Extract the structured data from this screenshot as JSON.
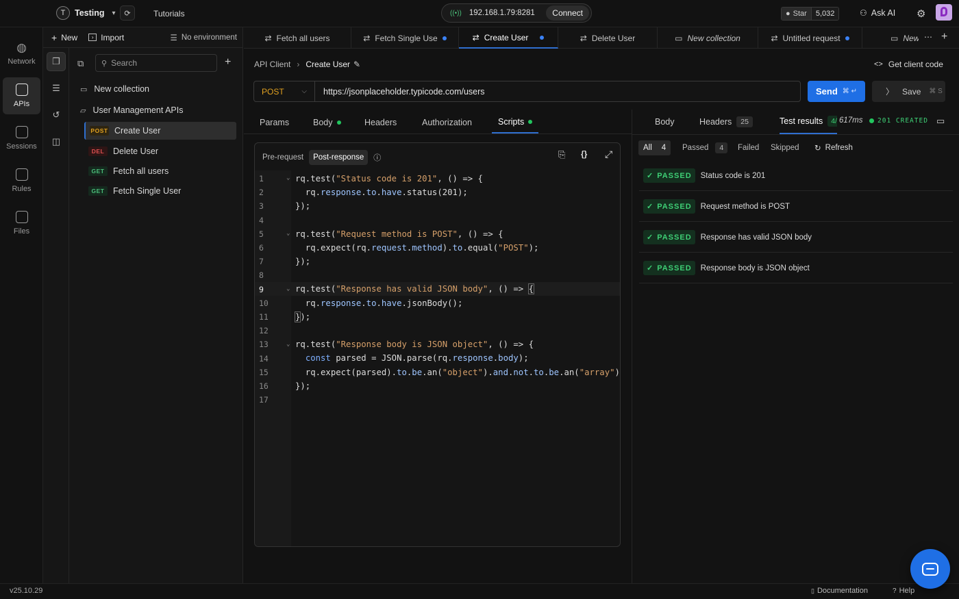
{
  "topbar": {
    "workspace_initial": "T",
    "workspace_name": "Testing",
    "tutorials": "Tutorials",
    "desktop_address": "192.168.1.79:8281",
    "connect": "Connect",
    "github_star": "Star",
    "github_count": "5,032",
    "ask_ai": "Ask AI"
  },
  "rail": {
    "items": [
      {
        "label": "Network",
        "icon": "globe-icon"
      },
      {
        "label": "APIs",
        "icon": "apis-icon"
      },
      {
        "label": "Sessions",
        "icon": "sessions-icon"
      },
      {
        "label": "Rules",
        "icon": "rules-icon"
      },
      {
        "label": "Files",
        "icon": "files-icon"
      }
    ]
  },
  "sidebar": {
    "new": "New",
    "import": "Import",
    "environment": "No environment",
    "search_placeholder": "Search",
    "tree": [
      {
        "label": "New collection"
      },
      {
        "label": "User Management APIs"
      },
      {
        "method": "POST",
        "label": "Create User"
      },
      {
        "method": "DEL",
        "label": "Delete User"
      },
      {
        "method": "GET",
        "label": "Fetch all users"
      },
      {
        "method": "GET",
        "label": "Fetch Single User"
      }
    ]
  },
  "tabs": [
    {
      "label": "Fetch all users"
    },
    {
      "label": "Fetch Single Use"
    },
    {
      "label": "Create User"
    },
    {
      "label": "Delete User"
    },
    {
      "label": "New collection"
    },
    {
      "label": "Untitled request"
    },
    {
      "label": "New"
    }
  ],
  "request": {
    "breadcrumb_root": "API Client",
    "breadcrumb_current": "Create User",
    "get_client_code": "Get client code",
    "method": "POST",
    "url": "https://jsonplaceholder.typicode.com/users",
    "send": "Send",
    "send_shortcut": "⌘ ↵",
    "save": "Save",
    "save_shortcut": "⌘ S",
    "subtabs": [
      "Params",
      "Body",
      "Headers",
      "Authorization",
      "Scripts"
    ]
  },
  "editor": {
    "pre_request": "Pre-request",
    "post_response": "Post-response",
    "line_numbers": [
      "1",
      "2",
      "3",
      "4",
      "5",
      "6",
      "7",
      "8",
      "9",
      "10",
      "11",
      "12",
      "13",
      "14",
      "15",
      "16",
      "17"
    ]
  },
  "response": {
    "tabs": {
      "body": "Body",
      "headers": "Headers",
      "headers_count": "25",
      "tests": "Test results",
      "tests_count": "4/"
    },
    "time": "617ms",
    "status": "201 CREATED",
    "filters": {
      "all": "All",
      "all_count": "4",
      "passed": "Passed",
      "passed_count": "4",
      "failed": "Failed",
      "skipped": "Skipped",
      "refresh": "Refresh"
    },
    "tests": [
      {
        "status": "PASSED",
        "name": "Status code is 201"
      },
      {
        "status": "PASSED",
        "name": "Request method is POST"
      },
      {
        "status": "PASSED",
        "name": "Response has valid JSON body"
      },
      {
        "status": "PASSED",
        "name": "Response body is JSON object"
      }
    ]
  },
  "footer": {
    "version": "v25.10.29",
    "documentation": "Documentation",
    "help": "Help"
  },
  "colors": {
    "accent": "#1f6fe5",
    "pass": "#3ecf75",
    "post": "#e0a020",
    "delete": "#e05050",
    "get": "#4bbf7a"
  }
}
